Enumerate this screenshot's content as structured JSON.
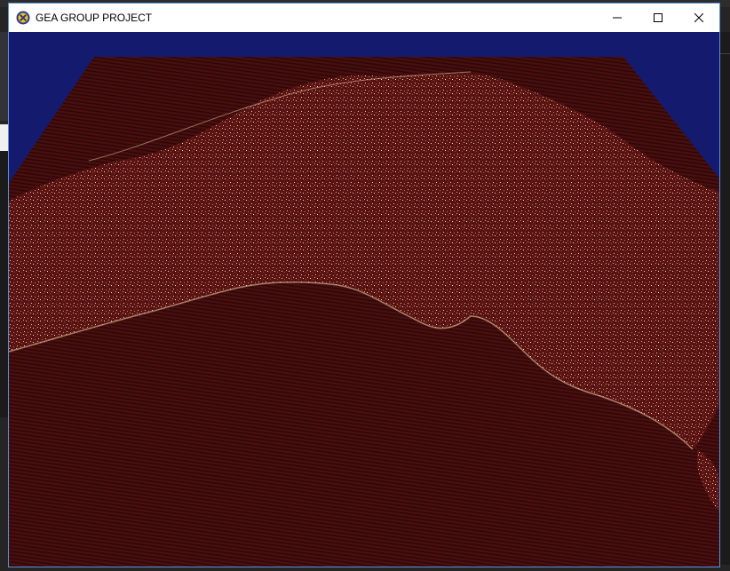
{
  "window": {
    "title": "GEA GROUP PROJECT",
    "app_icon": "x-circle-icon",
    "buttons": {
      "minimize": "minimize-icon",
      "maximize": "maximize-icon",
      "close": "close-icon"
    }
  },
  "viewport": {
    "description_icon": "3d-terrain-render",
    "colors": {
      "sky": "#141a6e",
      "terrain": "#4a0e0e",
      "terrain_dark": "#2a0707",
      "land_highlight": "#e8c8a0",
      "accent_window_border": "#5b8fd6"
    }
  }
}
